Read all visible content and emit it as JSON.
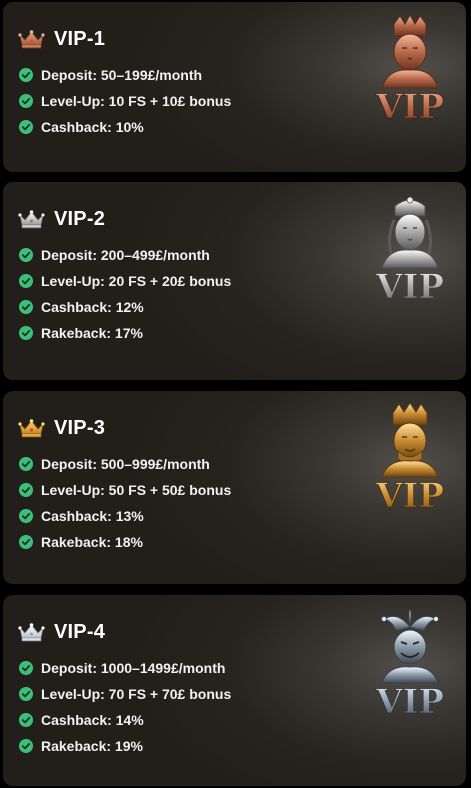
{
  "tiers": [
    {
      "title": "VIP-1",
      "crown_icon": "bronze-crown-icon",
      "badge_icon": "bronze-king-vip-badge",
      "badge_text": "VIP",
      "perks": [
        "Deposit: 50–199£/month",
        "Level-Up: 10 FS + 10£ bonus",
        "Cashback: 10%"
      ]
    },
    {
      "title": "VIP-2",
      "crown_icon": "silver-crown-icon",
      "badge_icon": "silver-queen-vip-badge",
      "badge_text": "VIP",
      "perks": [
        "Deposit: 200–499£/month",
        "Level-Up: 20 FS + 20£ bonus",
        "Cashback: 12%",
        "Rakeback: 17%"
      ]
    },
    {
      "title": "VIP-3",
      "crown_icon": "gold-crown-icon",
      "badge_icon": "gold-king-vip-badge",
      "badge_text": "VIP",
      "perks": [
        "Deposit: 500–999£/month",
        "Level-Up: 50 FS + 50£ bonus",
        "Cashback: 13%",
        "Rakeback: 18%"
      ]
    },
    {
      "title": "VIP-4",
      "crown_icon": "platinum-crown-icon",
      "badge_icon": "joker-vip-badge",
      "badge_text": "VIP",
      "perks": [
        "Deposit: 1000–1499£/month",
        "Level-Up: 70 FS + 70£ bonus",
        "Cashback: 14%",
        "Rakeback: 19%"
      ]
    }
  ],
  "colors": {
    "check": "#3dbf7a",
    "bronze": "#c07a5a",
    "silver": "#c9c9c9",
    "gold": "#d9a243",
    "platinum": "#aab6c2"
  }
}
